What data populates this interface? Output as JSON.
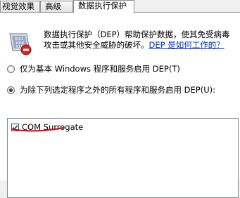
{
  "tabs": [
    {
      "label": "视觉效果"
    },
    {
      "label": "高级"
    },
    {
      "label": "数据执行保护"
    }
  ],
  "dep": {
    "description": "数据执行保护（DEP）帮助保护数据，使其免受病毒攻击或其他安全威胁的破坏。",
    "link": "DEP 是如何工作的？",
    "option_essential": "仅为基本 Windows 程序和服务启用 DEP(T)",
    "option_all_except": "为除下列选定程序之外的所有程序和服务启用 DEP(U):",
    "selected_option": "all_except",
    "exceptions": [
      {
        "name": "COM Surrogate",
        "checked": true
      }
    ]
  },
  "icon": "dep-shield-icon",
  "colors": {
    "link": "#0033cc",
    "annotation": "#e60012"
  }
}
